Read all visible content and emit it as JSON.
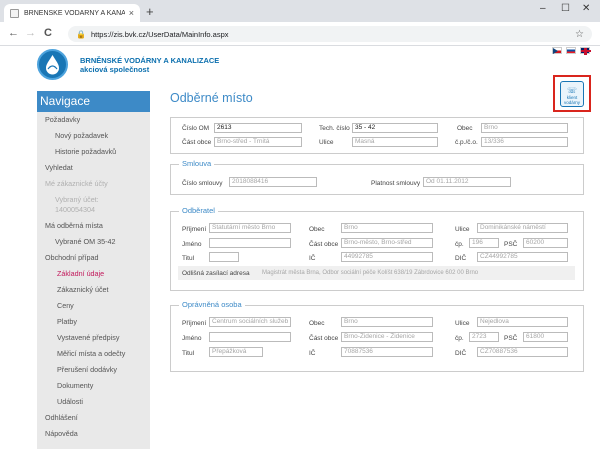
{
  "browser": {
    "tab_title": "BRNĚNSKÉ VODÁRNY A KANALIZ",
    "url": "https://zis.bvk.cz/UserData/MainInfo.aspx",
    "new_tab": "+",
    "close": "×",
    "back": "←",
    "forward": "→",
    "reload": "C",
    "home": "⌂",
    "lock": "🔒",
    "star": "☆",
    "minimize": "–",
    "maximize": "☐",
    "win_close": "✕"
  },
  "brand": {
    "line1": "BRNĚNSKÉ VODÁRNY A KANALIZACE",
    "line2": "akciová společnost"
  },
  "sticker": {
    "text": "klient vodárny"
  },
  "sidebar": {
    "title": "Navigace",
    "items": [
      {
        "label": "Požadavky"
      },
      {
        "label": "Nový požadavek"
      },
      {
        "label": "Historie požadavků"
      },
      {
        "label": "Vyhledat"
      },
      {
        "label": "Mé zákaznické účty"
      },
      {
        "label": "Vybraný účet:"
      },
      {
        "label": "1400054304"
      },
      {
        "label": "Má odběrná místa"
      },
      {
        "label": "Vybrané OM 35-42"
      },
      {
        "label": "Obchodní případ"
      },
      {
        "label": "Základní údaje"
      },
      {
        "label": "Zákaznický účet"
      },
      {
        "label": "Ceny"
      },
      {
        "label": "Platby"
      },
      {
        "label": "Vystavené předpisy"
      },
      {
        "label": "Měřicí místa a odečty"
      },
      {
        "label": "Přerušení dodávky"
      },
      {
        "label": "Dokumenty"
      },
      {
        "label": "Události"
      },
      {
        "label": "Odhlášení"
      },
      {
        "label": "Nápověda"
      }
    ]
  },
  "main": {
    "title": "Odběrné místo"
  },
  "om": {
    "cislo_om_label": "Číslo OM",
    "cislo_om": "2613",
    "tech_label": "Tech. číslo",
    "tech": "35 - 42",
    "obec_label": "Obec",
    "obec": "Brno",
    "cast_label": "Část obce",
    "cast": "Brno-střed - Trnitá",
    "ulice_label": "Ulice",
    "ulice": "Masná",
    "cp_label": "č.p./č.o.",
    "cp": "13/336"
  },
  "smlouva": {
    "legend": "Smlouva",
    "cislo_label": "Číslo smlouvy",
    "cislo": "2018088416",
    "platnost_label": "Platnost smlouvy",
    "platnost": "Od 01.11.2012"
  },
  "odberatel": {
    "legend": "Odběratel",
    "prijmeni_label": "Příjmení",
    "prijmeni": "Statutární město Brno",
    "obec_label": "Obec",
    "obec": "Brno",
    "ulice_label": "Ulice",
    "ulice": "Dominikánské náměstí",
    "jmeno_label": "Jméno",
    "jmeno": "",
    "cast_label": "Část obce",
    "cast": "Brno-město, Brno-střed",
    "cp_label": "čp.",
    "cp": "196",
    "psc_label": "PSČ",
    "psc": "60200",
    "titul_label": "Titul",
    "titul": "",
    "ic_label": "IČ",
    "ic": "44992785",
    "dic_label": "DIČ",
    "dic": "CZ44992785",
    "adresa_label": "Odlišná zasílací adresa",
    "adresa": "Magistrát města Brna, Odbor sociální péče Kolíšt 638/19 Zábrdovice 602 00 Brno"
  },
  "osoba": {
    "legend": "Oprávněná osoba",
    "prijmeni_label": "Příjmení",
    "prijmeni": "Centrum sociálních služeb",
    "obec_label": "Obec",
    "obec": "Brno",
    "ulice_label": "Ulice",
    "ulice": "Nejedlova",
    "jmeno_label": "Jméno",
    "jmeno": "",
    "cast_label": "Část obce",
    "cast": "Brno-Židenice - Židenice",
    "cp_label": "čp.",
    "cp": "2723",
    "psc_label": "PSČ",
    "psc": "61800",
    "titul_label": "Titul",
    "titul": "Přepážková",
    "ic_label": "IČ",
    "ic": "70887536",
    "dic_label": "DIČ",
    "dic": "CZ70887536"
  }
}
